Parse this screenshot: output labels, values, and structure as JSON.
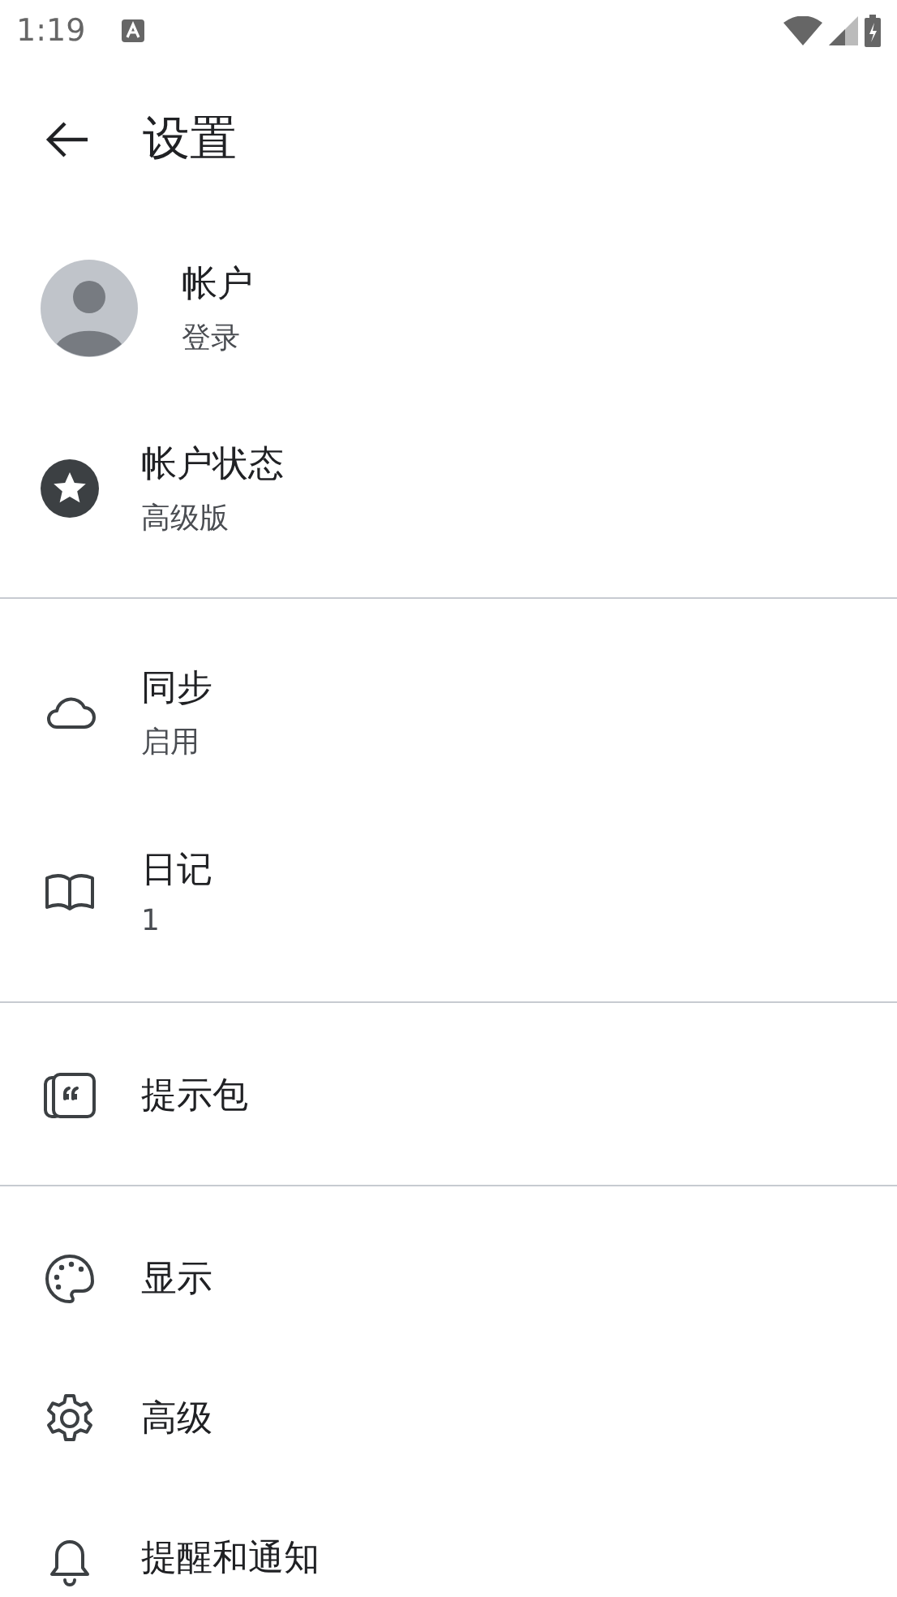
{
  "status_bar": {
    "time": "1:19"
  },
  "header": {
    "title": "设置"
  },
  "sections": [
    {
      "items": [
        {
          "kind": "avatar",
          "label": "帐户",
          "subtitle": "登录"
        },
        {
          "kind": "icon",
          "label": "帐户状态",
          "subtitle": "高级版"
        }
      ]
    },
    {
      "items": [
        {
          "kind": "icon",
          "label": "同步",
          "subtitle": "启用"
        },
        {
          "kind": "icon",
          "label": "日记",
          "subtitle": "1"
        }
      ]
    },
    {
      "items": [
        {
          "kind": "icon",
          "label": "提示包"
        }
      ]
    },
    {
      "items": [
        {
          "kind": "icon",
          "label": "显示"
        },
        {
          "kind": "icon",
          "label": "高级"
        },
        {
          "kind": "icon",
          "label": "提醒和通知"
        }
      ]
    }
  ]
}
